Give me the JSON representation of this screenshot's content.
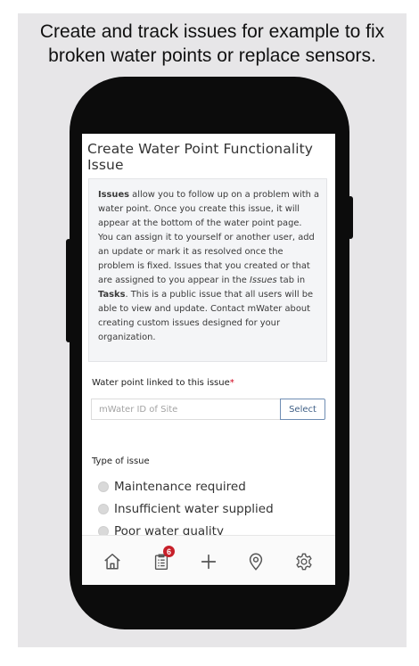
{
  "caption": {
    "line1": "Create and track issues for example to fix",
    "line2": "broken water points or replace sensors."
  },
  "screen": {
    "title": "Create Water Point Functionality Issue",
    "info": {
      "issues_word": "Issues",
      "text_a": " allow you to follow up on a problem with a water point. Once you create this issue, it will appear at the bottom of the water point page. You can assign it to yourself or another user, add an update or mark it as resolved once the problem is fixed. Issues that you created or that are assigned to you appear in the ",
      "issues_italic": "Issues",
      "text_b": " tab in ",
      "tasks_word": "Tasks",
      "text_c": ". This is a public issue that all users will be able to view and update. Contact mWater about creating custom issues designed for your organization."
    },
    "water_point": {
      "label": "Water point linked to this issue",
      "required_mark": "*",
      "placeholder": "mWater ID of Site",
      "select_label": "Select"
    },
    "issue_type": {
      "label": "Type of issue",
      "options": [
        "Maintenance required",
        "Insufficient water supplied",
        "Poor water quality"
      ]
    }
  },
  "navbar": {
    "icons": [
      "home-icon",
      "tasks-icon",
      "plus-icon",
      "location-pin-icon",
      "gear-icon"
    ],
    "tasks_badge": "6",
    "icon_color": "#555555",
    "badge_color": "#c7202a"
  }
}
